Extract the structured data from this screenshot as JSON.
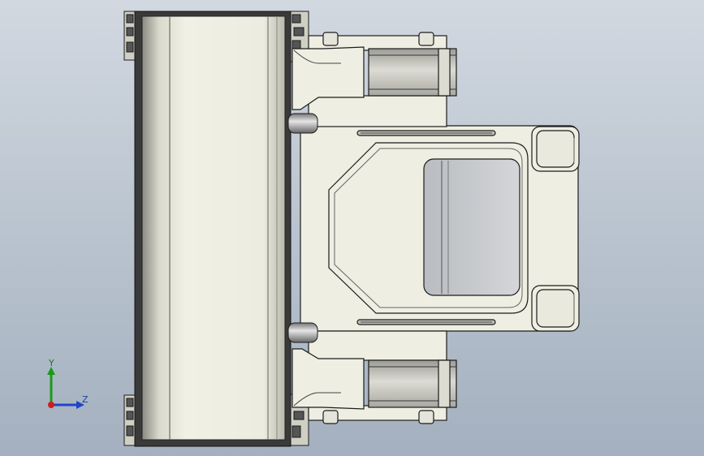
{
  "colors": {
    "background_top": "#d2d8e0",
    "background_bottom": "#a4b0bf",
    "part_fill": "#eeeee2",
    "part_edge": "#1c1c1c",
    "frame_dark": "#3a3a3a",
    "glass": "#c5c8cc",
    "axis_y": "#1a9a1a",
    "axis_z": "#1f45c8",
    "axis_x": "#d01c1c"
  },
  "triad": {
    "y_label": "Y",
    "z_label": "Z"
  }
}
